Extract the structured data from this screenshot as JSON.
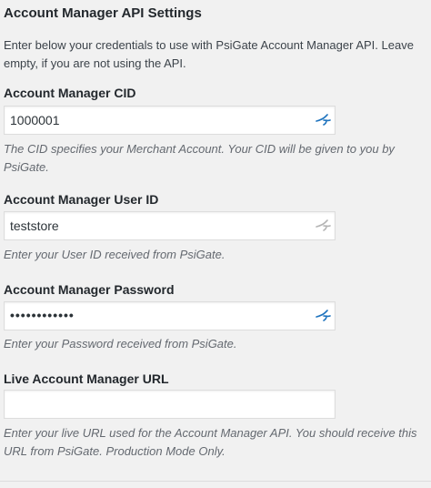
{
  "section": {
    "title": "Account Manager API Settings",
    "description": "Enter below your credentials to use with PsiGate Account Manager API. Leave empty, if you are not using the API."
  },
  "fields": {
    "cid": {
      "label": "Account Manager CID",
      "value": "1000001",
      "help": "The CID specifies your Merchant Account. Your CID will be given to you by PsiGate.",
      "icon": "password-manager-icon",
      "icon_color": "#1e73be"
    },
    "user_id": {
      "label": "Account Manager User ID",
      "value": "teststore",
      "help": "Enter your User ID received from PsiGate.",
      "icon": "password-manager-icon",
      "icon_color": "#b4b4b4"
    },
    "password": {
      "label": "Account Manager Password",
      "value": "••••••••••••",
      "help": "Enter your Password received from PsiGate.",
      "icon": "password-manager-icon",
      "icon_color": "#1e73be"
    },
    "url": {
      "label": "Live Account Manager URL",
      "value": "",
      "help": "Enter your live URL used for the Account Manager API. You should receive this URL from PsiGate. Production Mode Only."
    }
  }
}
